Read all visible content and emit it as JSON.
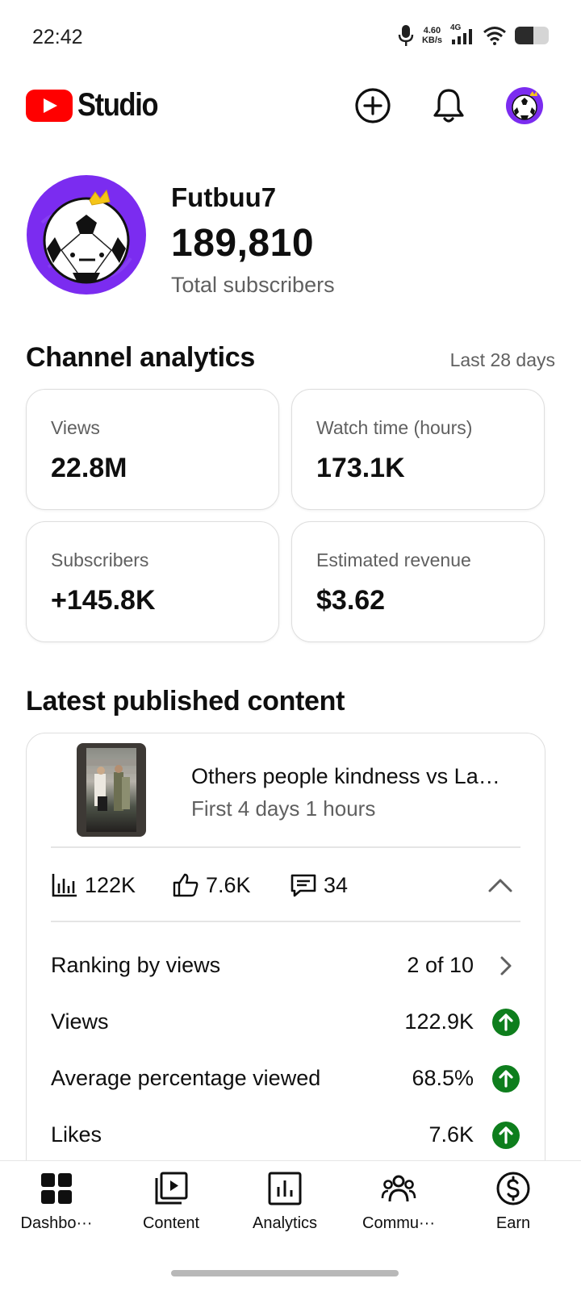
{
  "status_bar": {
    "time": "22:42",
    "net_speed_value": "4.60",
    "net_speed_unit": "KB/s",
    "network": "4G",
    "battery_level": 0.55
  },
  "header": {
    "app_name": "Studio",
    "icons": [
      "create-icon",
      "notifications-icon",
      "account-avatar"
    ]
  },
  "channel": {
    "name": "Futbuu7",
    "subscribers": "189,810",
    "subscribers_label": "Total subscribers"
  },
  "analytics": {
    "title": "Channel analytics",
    "period": "Last 28 days",
    "cards": [
      {
        "label": "Views",
        "value": "22.8M"
      },
      {
        "label": "Watch time (hours)",
        "value": "173.1K"
      },
      {
        "label": "Subscribers",
        "value": "+145.8K"
      },
      {
        "label": "Estimated revenue",
        "value": "$3.62"
      }
    ]
  },
  "latest": {
    "title": "Latest published content",
    "video_title": "Others people kindness vs La…",
    "video_sub": "First 4 days 1 hours",
    "stats": {
      "views": "122K",
      "likes": "7.6K",
      "comments": "34"
    },
    "metrics": [
      {
        "label": "Ranking by views",
        "value": "2 of 10",
        "indicator": "chevron-right"
      },
      {
        "label": "Views",
        "value": "122.9K",
        "indicator": "up-arrow"
      },
      {
        "label": "Average percentage viewed",
        "value": "68.5%",
        "indicator": "up-arrow"
      },
      {
        "label": "Likes",
        "value": "7.6K",
        "indicator": "up-arrow"
      }
    ]
  },
  "colors": {
    "brand_red": "#ff0000",
    "avatar_purple": "#7b2cf0",
    "positive_green": "#0e7e1d",
    "muted_text": "#606060"
  },
  "bottom_nav": {
    "items": [
      {
        "label": "Dashbo···",
        "icon": "dashboard-icon"
      },
      {
        "label": "Content",
        "icon": "content-icon"
      },
      {
        "label": "Analytics",
        "icon": "analytics-icon"
      },
      {
        "label": "Commu···",
        "icon": "community-icon"
      },
      {
        "label": "Earn",
        "icon": "earn-icon"
      }
    ]
  }
}
